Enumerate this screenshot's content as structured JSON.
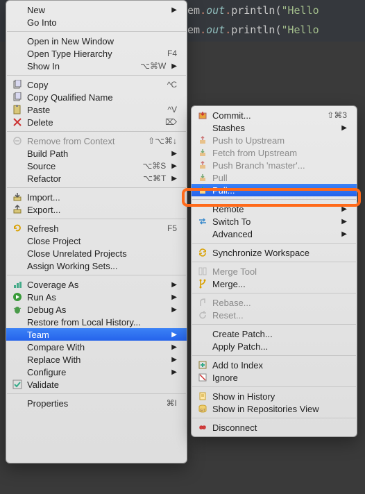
{
  "code": {
    "line1_prefix": "em",
    "line1_dot1": ".",
    "line1_out": "out",
    "line1_dot2": ".",
    "line1_fn": "println",
    "line1_paren": "(",
    "line1_str": "\"Hello",
    "line2_prefix": "em",
    "line2_dot1": ".",
    "line2_out": "out",
    "line2_dot2": ".",
    "line2_fn": "println",
    "line2_paren": "(",
    "line2_str": "\"Hello"
  },
  "main": {
    "new": "New",
    "go_into": "Go Into",
    "open_new_window": "Open in New Window",
    "open_type_hierarchy": "Open Type Hierarchy",
    "open_type_hierarchy_accel": "F4",
    "show_in": "Show In",
    "show_in_accel": "⌥⌘W",
    "copy": "Copy",
    "copy_accel": "^C",
    "copy_qualified": "Copy Qualified Name",
    "paste": "Paste",
    "paste_accel": "^V",
    "delete": "Delete",
    "delete_accel": "⌦",
    "remove_context": "Remove from Context",
    "remove_context_accel": "⇧⌥⌘↓",
    "build_path": "Build Path",
    "source": "Source",
    "source_accel": "⌥⌘S",
    "refactor": "Refactor",
    "refactor_accel": "⌥⌘T",
    "import": "Import...",
    "export": "Export...",
    "refresh": "Refresh",
    "refresh_accel": "F5",
    "close_project": "Close Project",
    "close_unrelated": "Close Unrelated Projects",
    "assign_ws": "Assign Working Sets...",
    "coverage_as": "Coverage As",
    "run_as": "Run As",
    "debug_as": "Debug As",
    "restore_history": "Restore from Local History...",
    "team": "Team",
    "compare_with": "Compare With",
    "replace_with": "Replace With",
    "configure": "Configure",
    "validate": "Validate",
    "properties": "Properties",
    "properties_accel": "⌘I"
  },
  "sub": {
    "commit": "Commit...",
    "commit_accel": "⇧⌘3",
    "stashes": "Stashes",
    "push_upstream": "Push to Upstream",
    "fetch_upstream": "Fetch from Upstream",
    "push_branch": "Push Branch 'master'...",
    "pull": "Pull",
    "pull_dots": "Pull...",
    "remote": "Remote",
    "switch_to": "Switch To",
    "advanced": "Advanced",
    "sync_workspace": "Synchronize Workspace",
    "merge_tool": "Merge Tool",
    "merge": "Merge...",
    "rebase": "Rebase...",
    "reset": "Reset...",
    "create_patch": "Create Patch...",
    "apply_patch": "Apply Patch...",
    "add_index": "Add to Index",
    "ignore": "Ignore",
    "show_history": "Show in History",
    "show_repo": "Show in Repositories View",
    "disconnect": "Disconnect"
  },
  "colors": {
    "highlight": "#ff6a1a"
  }
}
